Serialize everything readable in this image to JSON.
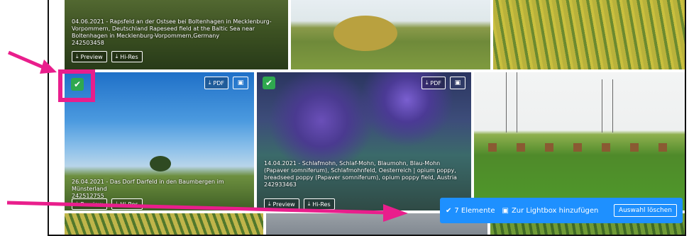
{
  "tiles": {
    "rapsfeld": {
      "caption": "04.06.2021 - Rapsfeld an der Ostsee bei Boltenhagen in Mecklenburg-Vorpommern, Deutschland Rapeseed field at the Baltic Sea near Boltenhagen in Mecklenburg-Vorpommern,Germany",
      "id": "242503458",
      "preview": "Preview",
      "hires": "Hi-Res"
    },
    "darfeld": {
      "caption": "26.04.2021 - Das Dorf Darfeld in den Baumbergen im Münsterland",
      "id": "242512755",
      "preview": "Preview",
      "hires": "Hi-Res",
      "pdf": "PDF"
    },
    "mohn": {
      "caption": "14.04.2021 - Schlafmohn, Schlaf-Mohn, Blaumohn, Blau-Mohn (Papaver somniferum), Schlafmohnfeld, Oesterreich | opium poppy, breadseed poppy (Papaver somniferum), opium poppy field, Austria",
      "id": "242933463",
      "preview": "Preview",
      "hires": "Hi-Res",
      "pdf": "PDF"
    }
  },
  "selection_bar": {
    "count_label": "7 Elemente",
    "lightbox_label": "Zur Lightbox hinzufügen",
    "clear_label": "Auswahl löschen"
  },
  "colors": {
    "accent": "#1e90ff",
    "check": "#2fa84f",
    "annotation": "#e91e8c"
  }
}
